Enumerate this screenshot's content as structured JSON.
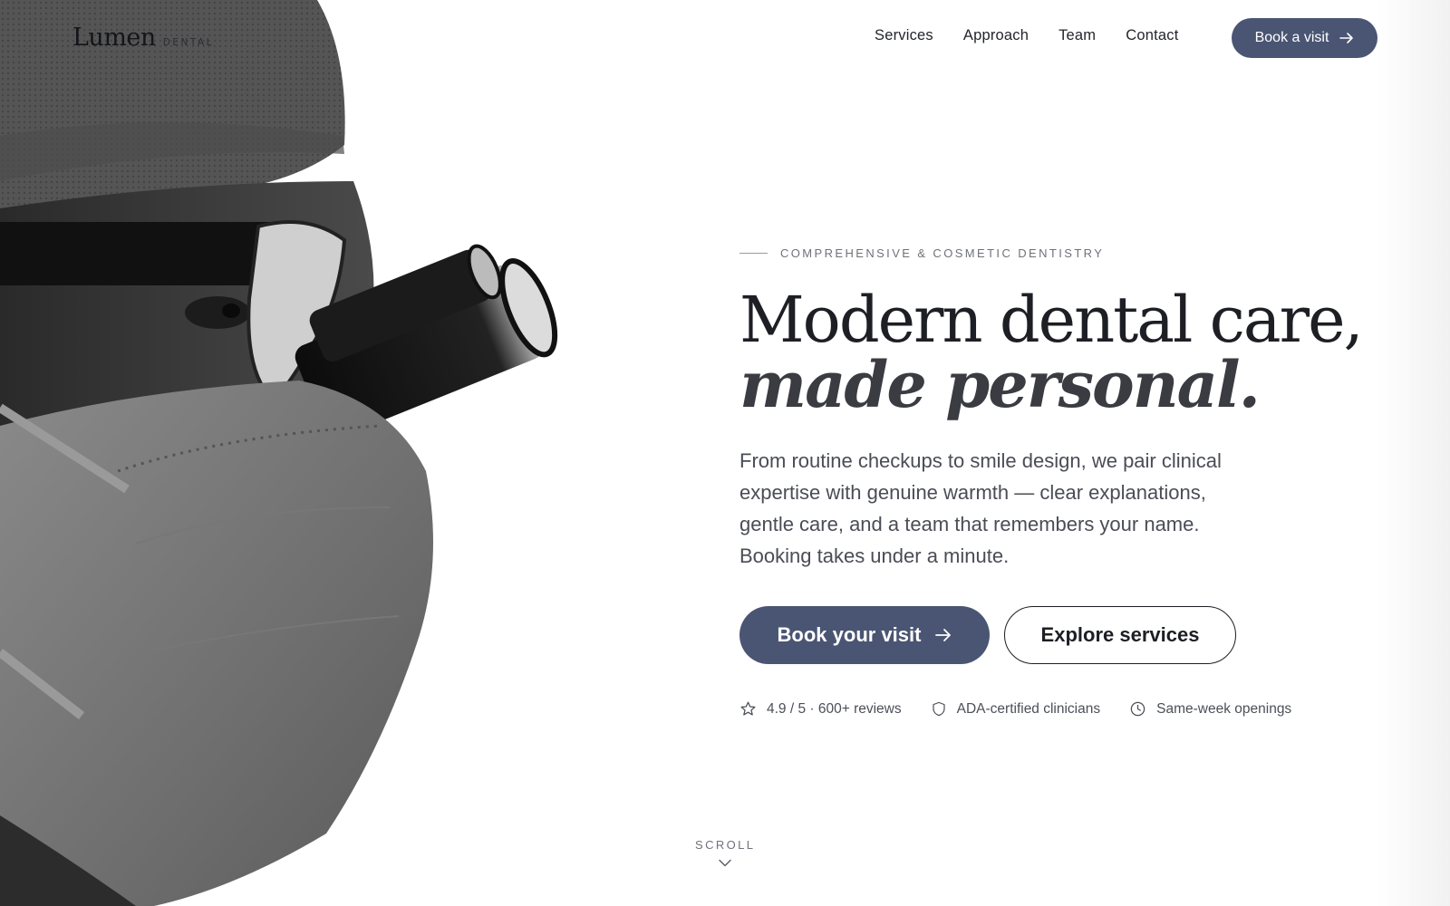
{
  "brand": {
    "name": "Lumen",
    "sub": "DENTAL"
  },
  "nav": {
    "links": [
      "Services",
      "Approach",
      "Team",
      "Contact"
    ],
    "cta_label": "Book a visit"
  },
  "hero": {
    "eyebrow": "COMPREHENSIVE & COSMETIC DENTISTRY",
    "headline_line1": "Modern dental care,",
    "headline_line2": "made personal.",
    "lede": "From routine checkups to smile design, we pair clinical expertise with genuine warmth — clear explanations, gentle care, and a team that remembers your name. Booking takes under a minute.",
    "primary_cta": "Book your visit",
    "secondary_cta": "Explore services",
    "trust": [
      {
        "icon": "star-icon",
        "text": "4.9 / 5 · 600+ reviews"
      },
      {
        "icon": "shield-icon",
        "text": "ADA-certified clinicians"
      },
      {
        "icon": "clock-icon",
        "text": "Same-week openings"
      }
    ]
  },
  "scroll_label": "SCROLL",
  "colors": {
    "accent": "#4a5573",
    "text": "#1f2126",
    "muted": "#6f727a"
  }
}
